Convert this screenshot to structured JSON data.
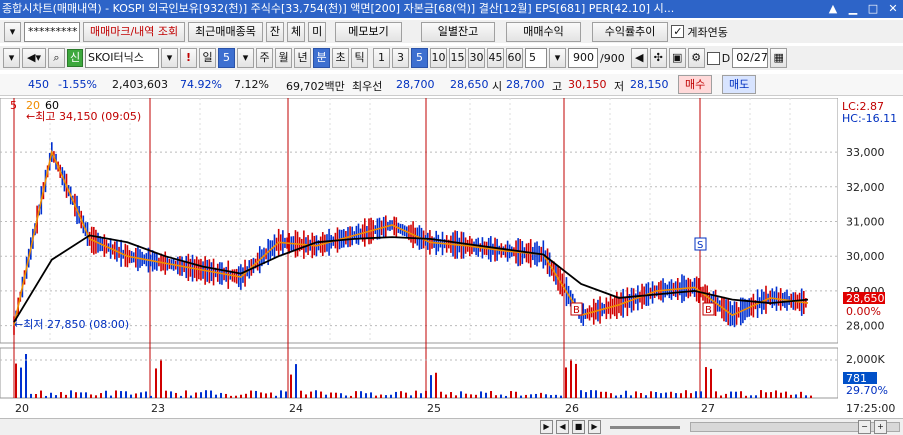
{
  "window": {
    "title": "종합시차트(매매내역) - KOSPI 외국인보유[932(천)] 주식수[33,754(천)] 액면[200] 자본금[68(억)] 결산[12월] EPS[681] PER[42.10] 시..."
  },
  "toolbar1": {
    "code_value": "*********",
    "buttons": [
      "매매마크/내역 조회",
      "최근매매종목",
      "잔",
      "체",
      "미",
      "메모보기",
      "일별잔고",
      "매매수익",
      "수익률추이"
    ],
    "checkbox_label": "계좌연동"
  },
  "toolbar2": {
    "stock_name": "SKOI터닉스",
    "type_label": "신",
    "period_day": "일",
    "period_num": "5",
    "periods": [
      "주",
      "월",
      "년",
      "분",
      "초",
      "틱"
    ],
    "intervals": [
      "1",
      "3",
      "5",
      "10",
      "15",
      "30",
      "45",
      "60"
    ],
    "count_value": "5",
    "bars_value": "900",
    "bars_total": "/900",
    "date_label": "D",
    "date_value": "02/27"
  },
  "quote": {
    "change": "450",
    "change_rate": "-1.55%",
    "volume": "2,403,603",
    "vol_ratio": "74.92%",
    "turnover": "7.12%",
    "amount": "69,702백만",
    "best_label": "최우선",
    "ask": "28,700",
    "bid": "28,650",
    "open_label": "시",
    "open": "28,700",
    "high_label": "고",
    "high": "30,150",
    "low_label": "저",
    "low": "28,150",
    "buy_label": "매수",
    "sell_label": "매도"
  },
  "chart": {
    "ma_labels": [
      "5",
      "20",
      "60"
    ],
    "high_annotation": "최고 34,150 (09:05)",
    "low_annotation": "최저 27,850 (08:00)",
    "lc_label": "LC:2.87",
    "hc_label": "HC:-16.11",
    "current_price": "28,650",
    "current_rate": "0.00%",
    "volume_current": "781",
    "volume_rate": "29.70%",
    "volume_axis_top": "2,000K",
    "time_label": "17:25:00",
    "day_labels": [
      "20",
      "23",
      "24",
      "25",
      "26",
      "27"
    ],
    "marks": [
      "B",
      "S",
      "B"
    ]
  },
  "chart_data": {
    "type": "line",
    "ylim": [
      27500,
      34500
    ],
    "yticks": [
      "33,000",
      "32,000",
      "31,000",
      "30,000",
      "29,000",
      "28,000"
    ],
    "ytick_values": [
      33000,
      32000,
      31000,
      30000,
      29000,
      28000
    ],
    "series": [
      {
        "name": "60",
        "values": [
          28100,
          29900,
          30600,
          30400,
          30000,
          29700,
          29500,
          30000,
          30400,
          30500,
          30550,
          30500,
          30350,
          30200,
          30050,
          29200,
          28800,
          28900,
          29000,
          28750,
          28650,
          28750
        ]
      },
      {
        "name": "5",
        "values": [
          28000,
          33000,
          30500,
          30000,
          29800,
          29600,
          29400,
          30400,
          30300,
          30600,
          30900,
          30400,
          30300,
          30150,
          30050,
          28300,
          28600,
          29000,
          29100,
          28300,
          28800,
          28650
        ]
      }
    ],
    "x_days": [
      "20",
      "23",
      "24",
      "25",
      "26",
      "27"
    ]
  }
}
